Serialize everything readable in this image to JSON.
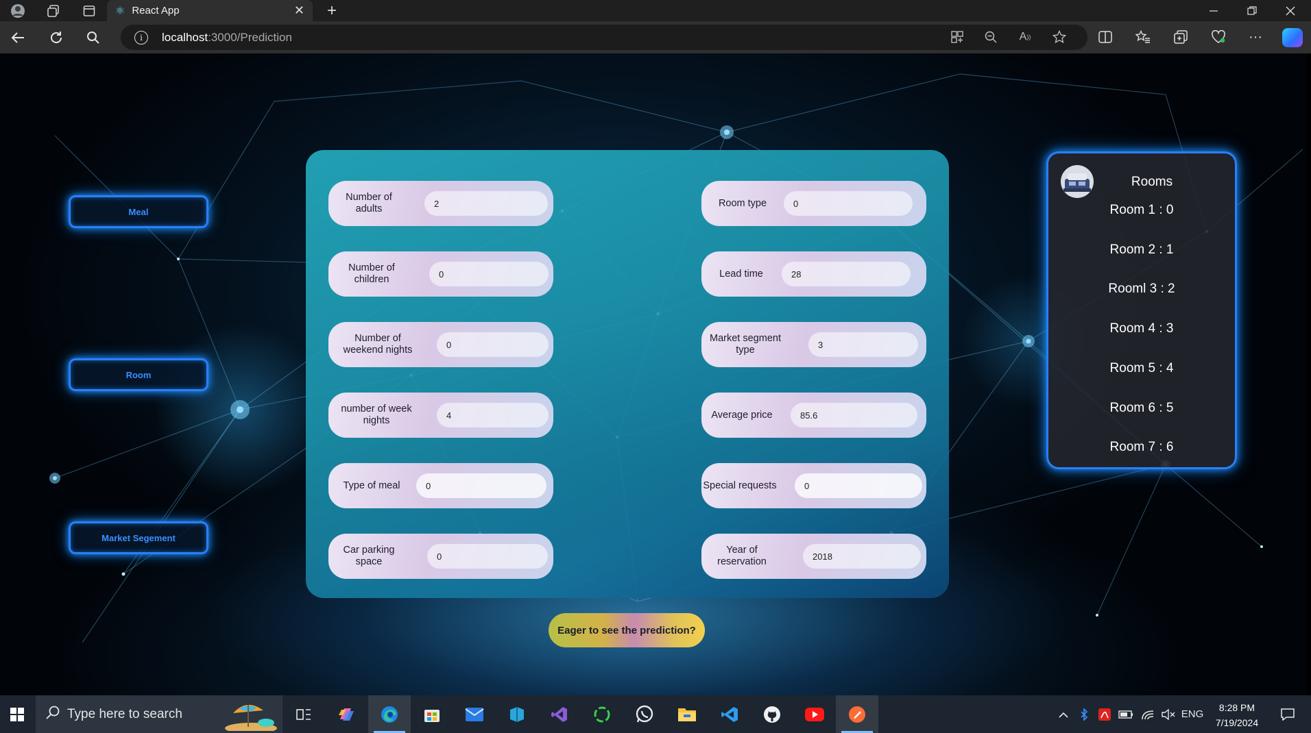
{
  "browser": {
    "tab_title": "React App",
    "tab_close": "✕",
    "new_tab": "+",
    "url_host": "localhost",
    "url_path": ":3000/Prediction"
  },
  "sidebar": {
    "meal_label": "Meal",
    "room_label": "Room",
    "market_label": "Market Segement"
  },
  "form": {
    "adults_label": "Number of adults",
    "adults_value": "2",
    "children_label": "Number of children",
    "children_value": "0",
    "weekend_label": "Number of weekend nights",
    "weekend_value": "0",
    "week_label": "number of week nights",
    "week_value": "4",
    "meal_label": "Type of meal",
    "meal_value": "0",
    "parking_label": "Car parking space",
    "parking_value": "0",
    "room_type_label": "Room type",
    "room_type_value": "0",
    "lead_time_label": "Lead time",
    "lead_time_value": "28",
    "market_label": "Market segment type",
    "market_value": "3",
    "price_label": "Average price",
    "price_value": "85.6",
    "special_label": "Special requests",
    "special_value": "0",
    "year_label": "Year of reservation",
    "year_value": "2018",
    "submit_label": "Eager to see the prediction?"
  },
  "rooms_panel": {
    "title": "Rooms",
    "items": [
      "Room 1 : 0",
      "Room 2 : 1",
      "Rooml 3 : 2",
      "Room 4 : 3",
      "Room 5 : 4",
      "Room 6 : 5",
      "Room 7 : 6"
    ]
  },
  "taskbar": {
    "search_placeholder": "Type here to search",
    "language": "ENG",
    "time": "8:28 PM",
    "date": "7/19/2024"
  },
  "colors": {
    "neon_blue": "#2a7fff",
    "card_teal": "#24aabe",
    "field_lavender": "#d9c9e6"
  }
}
